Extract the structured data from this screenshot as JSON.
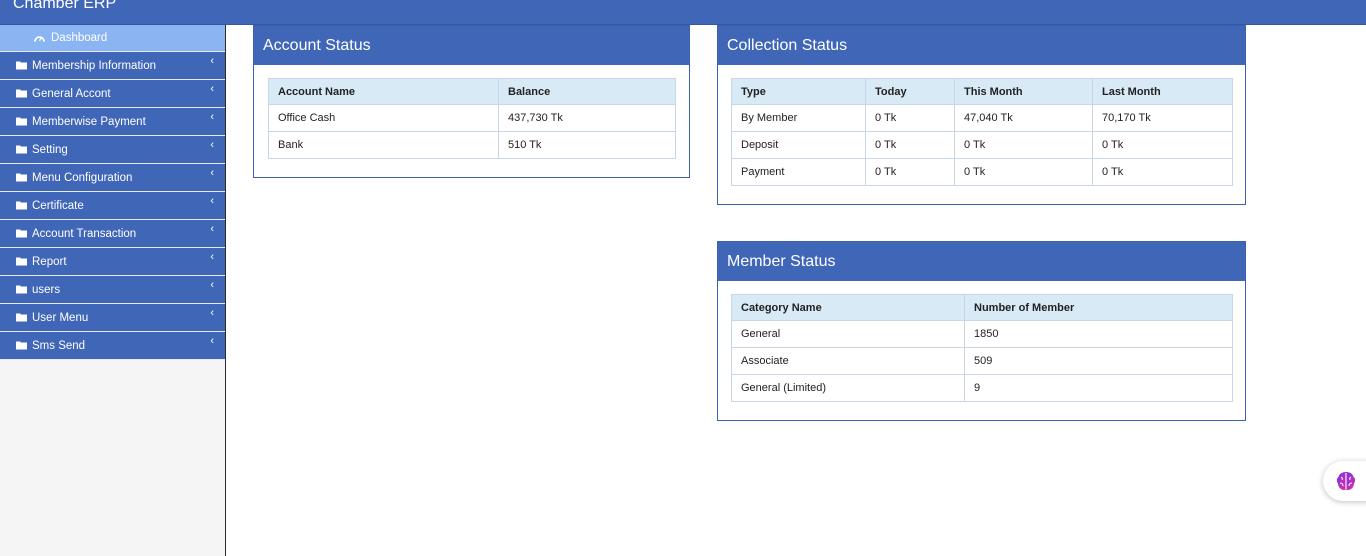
{
  "app": {
    "title": "Chamber ERP"
  },
  "sidebar": {
    "items": [
      {
        "label": "Dashboard",
        "icon": "dashboard-icon"
      },
      {
        "label": "Membership Information",
        "icon": "folder-icon"
      },
      {
        "label": "General Accont",
        "icon": "folder-icon"
      },
      {
        "label": "Memberwise Payment",
        "icon": "folder-icon"
      },
      {
        "label": "Setting",
        "icon": "folder-icon"
      },
      {
        "label": "Menu Configuration",
        "icon": "folder-icon"
      },
      {
        "label": "Certificate",
        "icon": "folder-icon"
      },
      {
        "label": "Account Transaction",
        "icon": "folder-icon"
      },
      {
        "label": "Report",
        "icon": "folder-icon"
      },
      {
        "label": "users",
        "icon": "folder-icon"
      },
      {
        "label": "User Menu",
        "icon": "folder-icon"
      },
      {
        "label": "Sms Send",
        "icon": "folder-icon"
      }
    ]
  },
  "account_status": {
    "title": "Account Status",
    "headers": [
      "Account Name",
      "Balance"
    ],
    "rows": [
      [
        "Office Cash",
        "437,730 Tk"
      ],
      [
        "Bank",
        "510 Tk"
      ]
    ]
  },
  "collection_status": {
    "title": "Collection Status",
    "headers": [
      "Type",
      "Today",
      "This Month",
      "Last Month"
    ],
    "rows": [
      [
        "By Member",
        "0 Tk",
        "47,040 Tk",
        "70,170 Tk"
      ],
      [
        "Deposit",
        "0 Tk",
        "0 Tk",
        "0 Tk"
      ],
      [
        "Payment",
        "0 Tk",
        "0 Tk",
        "0 Tk"
      ]
    ]
  },
  "member_status": {
    "title": "Member Status",
    "headers": [
      "Category Name",
      "Number of Member"
    ],
    "rows": [
      [
        "General",
        "1850"
      ],
      [
        "Associate",
        "509"
      ],
      [
        "General (Limited)",
        "9"
      ]
    ]
  },
  "colors": {
    "primary": "#4066b8",
    "active_item": "#8bb4f3",
    "table_header": "#d9eaf7"
  },
  "floating_button": {
    "icon": "brain-icon"
  }
}
